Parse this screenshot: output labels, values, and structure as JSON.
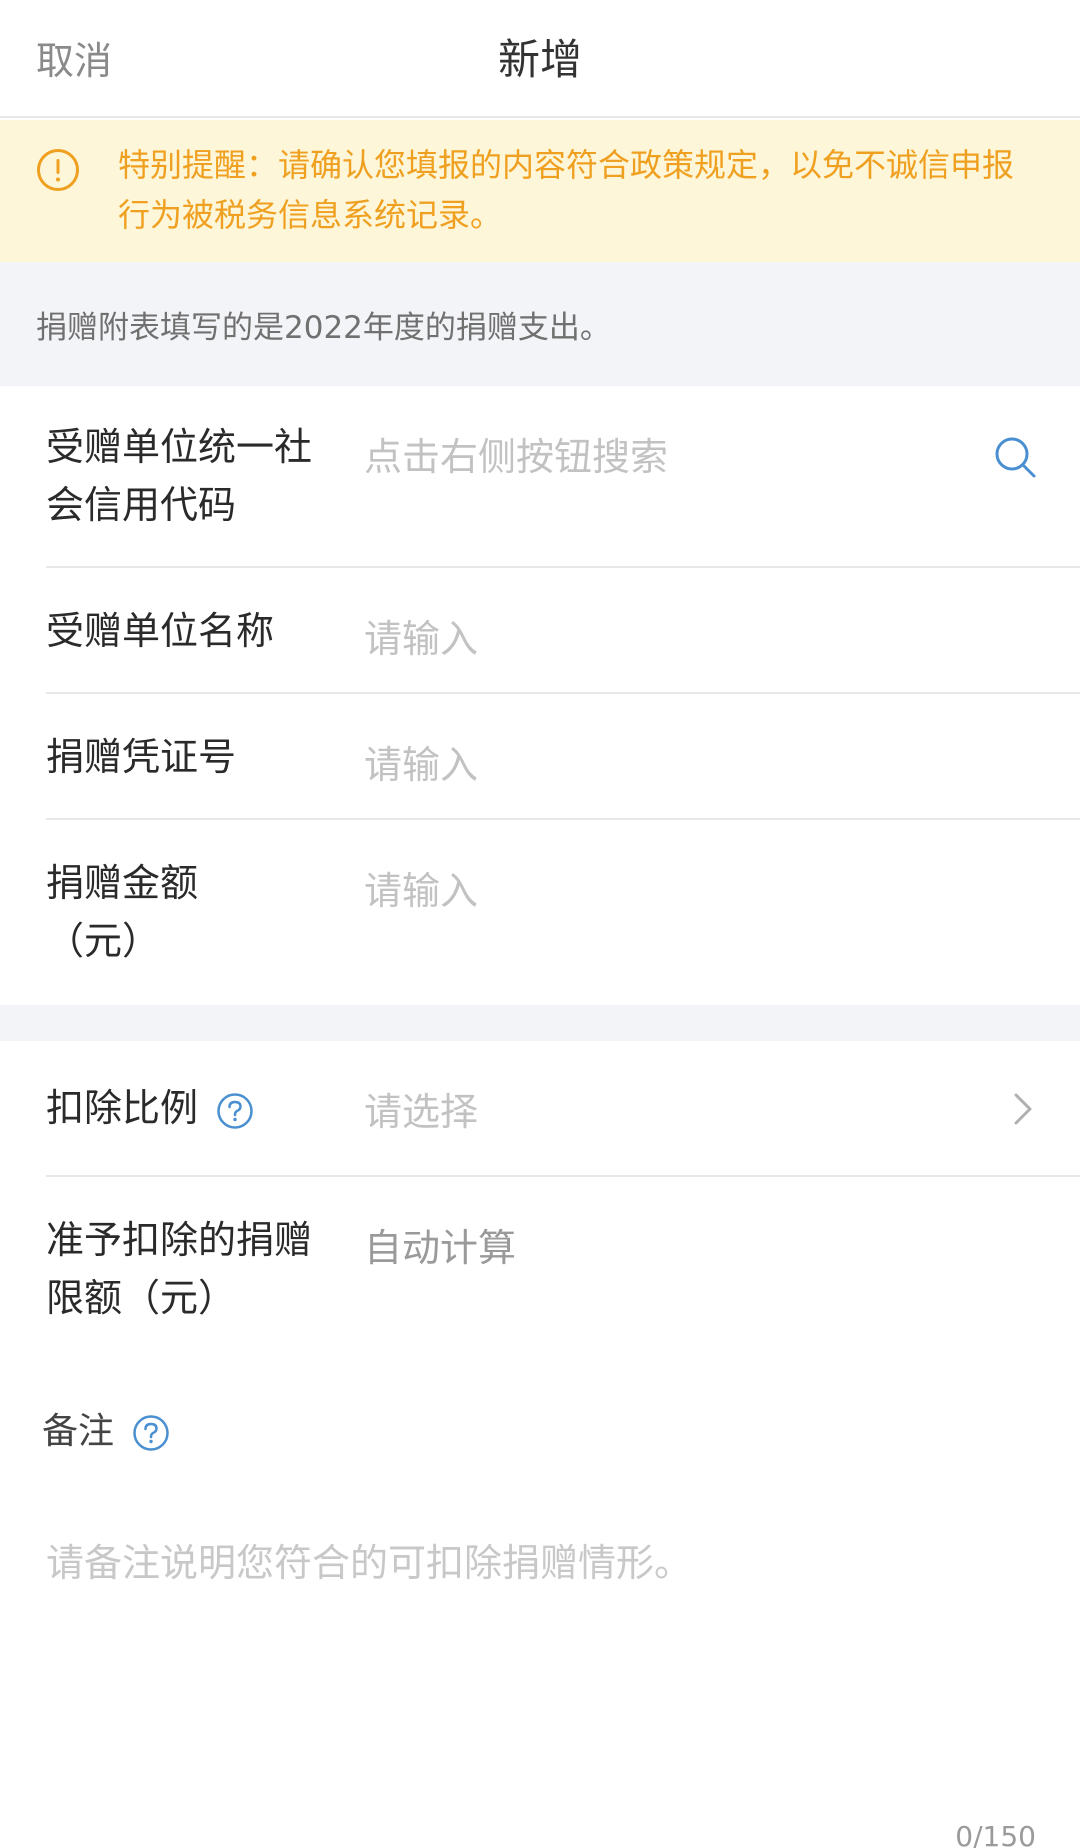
{
  "header": {
    "cancel_label": "取消",
    "title": "新增"
  },
  "notice": {
    "icon": "exclamation-circle-icon",
    "text": "特别提醒：请确认您填报的内容符合政策规定，以免不诚信申报行为被税务信息系统记录。"
  },
  "info": {
    "text": "捐赠附表填写的是2022年度的捐赠支出。"
  },
  "form": {
    "credit_code": {
      "label": "受赠单位统一社会信用代码",
      "placeholder": "点击右侧按钮搜索",
      "icon": "search-icon"
    },
    "unit_name": {
      "label": "受赠单位名称",
      "placeholder": "请输入"
    },
    "voucher_no": {
      "label": "捐赠凭证号",
      "placeholder": "请输入"
    },
    "amount": {
      "label": "捐赠金额（元）",
      "placeholder": "请输入"
    },
    "ratio": {
      "label": "扣除比例",
      "placeholder": "请选择",
      "help_icon": "question-circle-icon",
      "chevron_icon": "chevron-right-icon"
    },
    "limit": {
      "label": "准予扣除的捐赠限额（元）",
      "value": "自动计算"
    }
  },
  "remark": {
    "label": "备注",
    "help_icon": "question-circle-icon",
    "placeholder": "请备注说明您符合的可扣除捐赠情形。",
    "counter": "0/150"
  },
  "colors": {
    "notice_bg": "#fdf6d9",
    "notice_text": "#f0a020",
    "icon_blue": "#4a8fd0",
    "page_gray": "#f3f4f7"
  }
}
